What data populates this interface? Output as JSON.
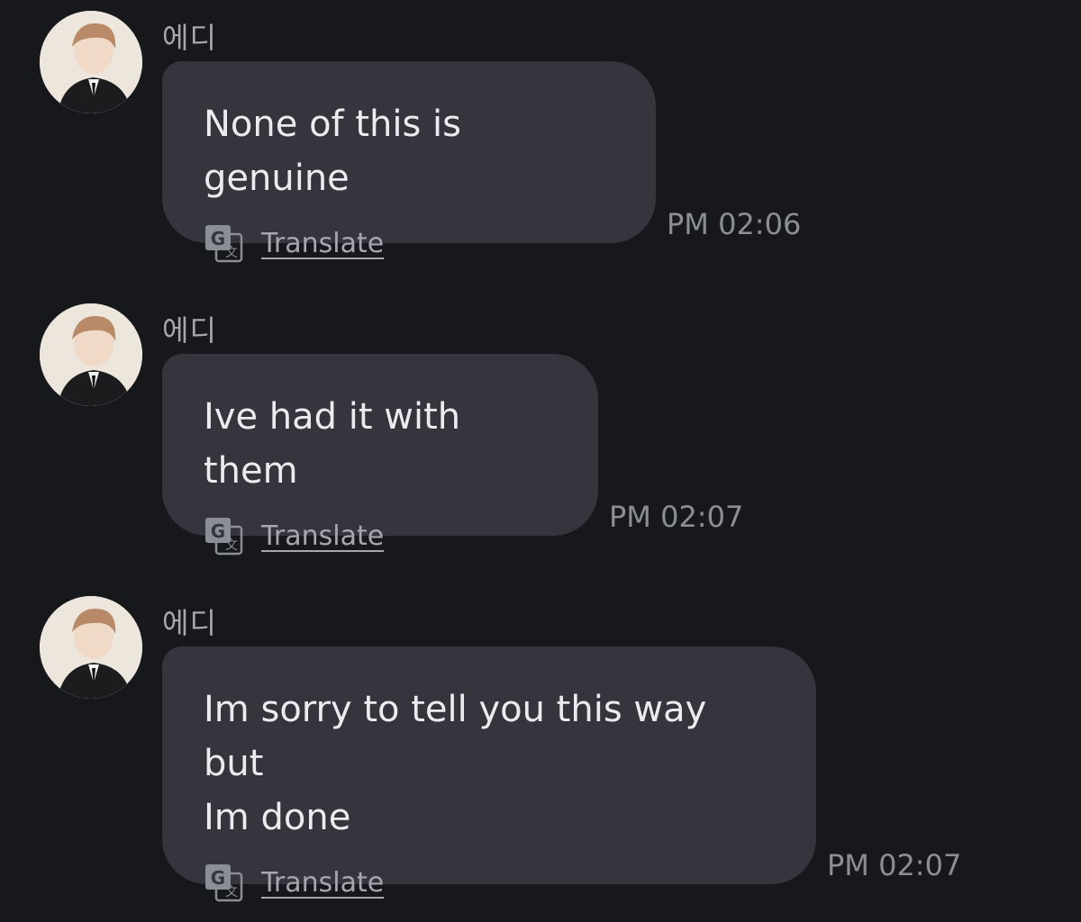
{
  "messages": [
    {
      "sender": "에디",
      "text": "None of this is genuine",
      "translate_label": "Translate",
      "time": "PM 02:06"
    },
    {
      "sender": "에디",
      "text": "Ive had it with them",
      "translate_label": "Translate",
      "time": "PM 02:07"
    },
    {
      "sender": "에디",
      "text": "Im sorry to tell you this way but\nIm done",
      "translate_label": "Translate",
      "time": "PM 02:07"
    }
  ],
  "colors": {
    "background": "#17181c",
    "bubble": "#34353d",
    "text": "#ececee",
    "muted": "#a6a8ae"
  },
  "icons": {
    "translate": "google-translate-icon",
    "avatar": "avatar"
  }
}
